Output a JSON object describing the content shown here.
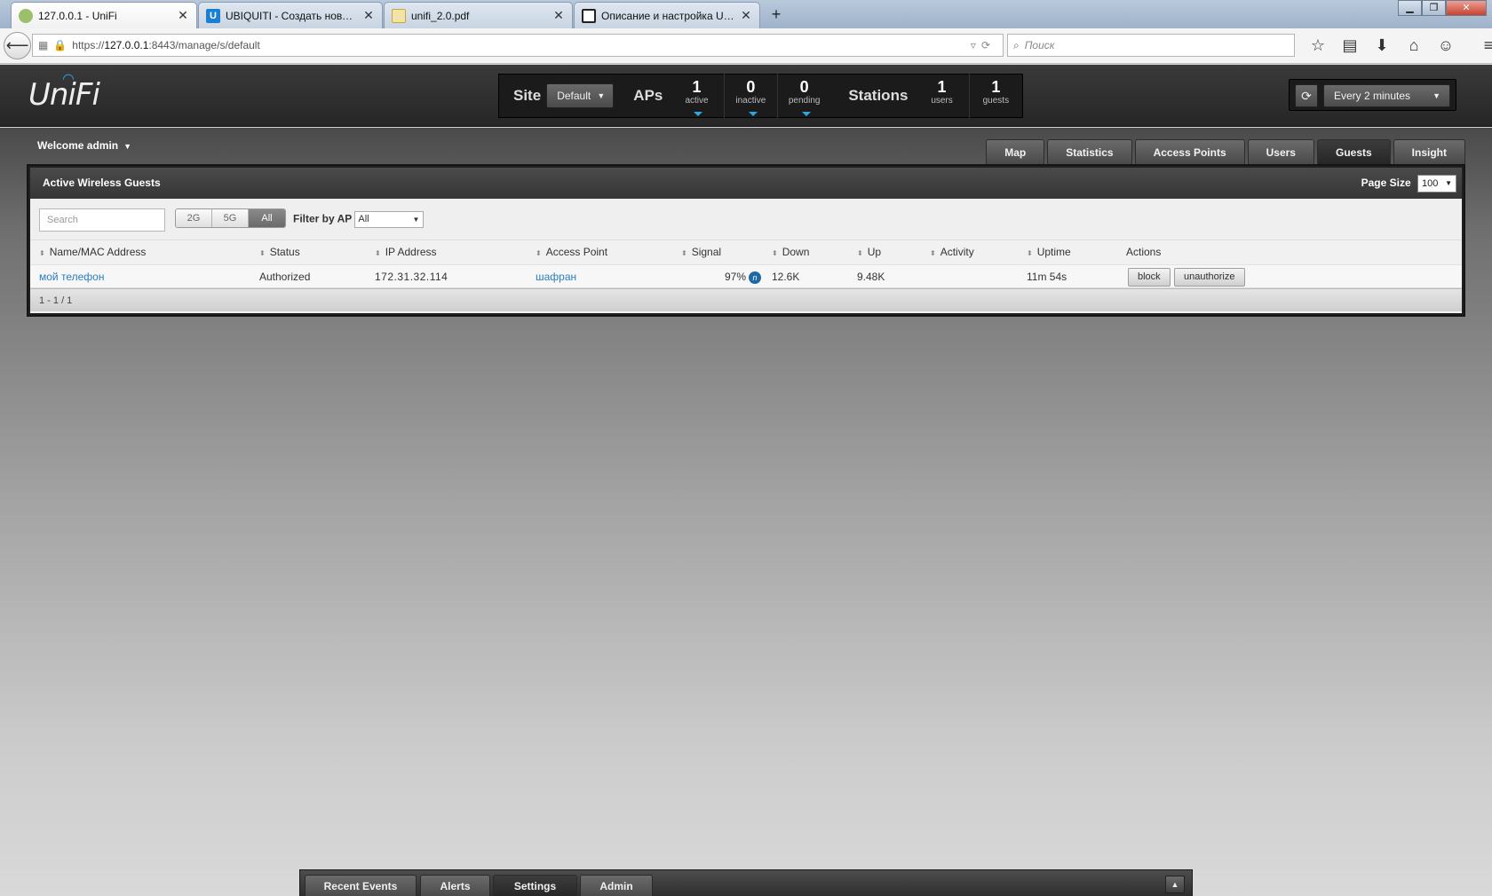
{
  "browser": {
    "tabs": [
      {
        "title": "127.0.0.1 - UniFi",
        "favicon": "unifi-globe-icon",
        "active": true
      },
      {
        "title": "UBIQUITI - Создать новую...",
        "favicon": "ubiquiti-u-icon",
        "active": false
      },
      {
        "title": "unifi_2.0.pdf",
        "favicon": "pdf-icon",
        "active": false
      },
      {
        "title": "Описание и настройка Ub...",
        "favicon": "grid-icon",
        "active": false
      }
    ],
    "new_tab": "+",
    "url_prefix": "https://",
    "url_host": "127.0.0.1",
    "url_rest": ":8443/manage/s/default",
    "search_placeholder": "Поиск"
  },
  "header": {
    "logo": "UniFi",
    "site_label": "Site",
    "site_value": "Default",
    "aps_label": "APs",
    "stats_aps": [
      {
        "value": "1",
        "label": "active"
      },
      {
        "value": "0",
        "label": "inactive"
      },
      {
        "value": "0",
        "label": "pending"
      }
    ],
    "stations_label": "Stations",
    "stats_stations": [
      {
        "value": "1",
        "label": "users"
      },
      {
        "value": "1",
        "label": "guests"
      }
    ],
    "refresh_interval": "Every 2 minutes"
  },
  "welcome": "Welcome admin",
  "nav_tabs": [
    {
      "label": "Map",
      "active": false
    },
    {
      "label": "Statistics",
      "active": false
    },
    {
      "label": "Access Points",
      "active": false
    },
    {
      "label": "Users",
      "active": false
    },
    {
      "label": "Guests",
      "active": true
    },
    {
      "label": "Insight",
      "active": false
    }
  ],
  "panel": {
    "title": "Active Wireless Guests",
    "page_size_label": "Page Size",
    "page_size_value": "100",
    "search_placeholder": "Search",
    "band_filters": [
      "2G",
      "5G",
      "All"
    ],
    "band_selected": "All",
    "filter_ap_label": "Filter by AP",
    "filter_ap_value": "All",
    "columns": [
      "Name/MAC Address",
      "Status",
      "IP Address",
      "Access Point",
      "Signal",
      "Down",
      "Up",
      "Activity",
      "Uptime",
      "Actions"
    ],
    "rows": [
      {
        "name": "мой телефон",
        "status": "Authorized",
        "ip": "172.31.32.114",
        "ap": "шафран",
        "signal": "97%",
        "signal_badge": "n",
        "down": "12.6K",
        "up": "9.48K",
        "activity": "",
        "uptime": "11m 54s",
        "actions": [
          "block",
          "unauthorize"
        ]
      }
    ],
    "pagination": "1 - 1 / 1"
  },
  "dock_tabs": [
    {
      "label": "Recent Events",
      "active": false
    },
    {
      "label": "Alerts",
      "active": false
    },
    {
      "label": "Settings",
      "active": true
    },
    {
      "label": "Admin",
      "active": false
    }
  ],
  "colors": {
    "accent": "#2fa4e7",
    "link": "#2a7ec1"
  }
}
